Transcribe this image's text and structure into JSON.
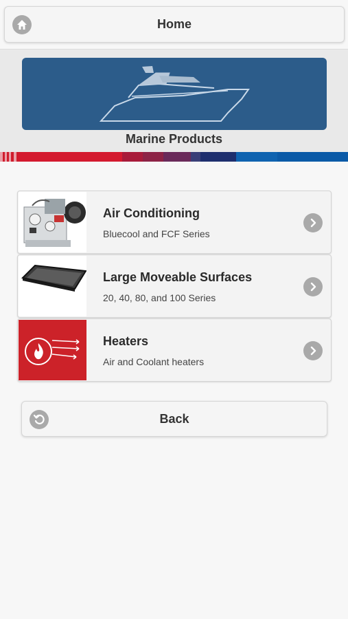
{
  "header": {
    "home_label": "Home",
    "home_icon": "home-icon"
  },
  "banner": {
    "image": "yacht-illustration",
    "title": "Marine Products"
  },
  "products": [
    {
      "title": "Air Conditioning",
      "subtitle": "Bluecool and FCF Series",
      "thumbnail": "air-conditioner-unit-photo"
    },
    {
      "title": "Large Moveable Surfaces",
      "subtitle": "20, 40, 80, and 100 Series",
      "thumbnail": "surface-panel-photo"
    },
    {
      "title": "Heaters",
      "subtitle": "Air and Coolant heaters",
      "thumbnail": "heater-flame-icon"
    }
  ],
  "footer": {
    "back_label": "Back",
    "back_icon": "back-arrow-icon"
  },
  "colors": {
    "banner_blue": "#2c5c8a",
    "heater_red": "#cc2229",
    "icon_grey": "#a9a9a9"
  }
}
